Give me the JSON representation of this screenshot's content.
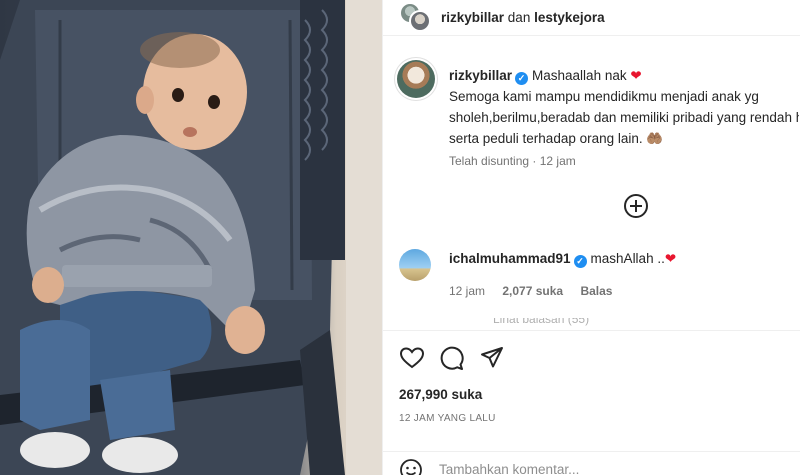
{
  "post": {
    "authors": {
      "primary": "rizkybillar",
      "conjunction": "dan",
      "secondary": "lestykejora"
    },
    "caption": {
      "username": "rizkybillar",
      "title": "Mashaallah nak",
      "title_emoji": "❤",
      "body_line1": "Semoga kami mampu mendidikmu menjadi anak yg",
      "body_line2": "sholeh,berilmu,beradab dan memiliki pribadi yang rendah hati",
      "body_line3": "serta peduli terhadap orang lain.",
      "body_emoji": "🤲🏽",
      "edited_label": "Telah disunting",
      "separator": "·",
      "time_ago": "12 jam"
    },
    "load_more_icon": "plus-circle-icon",
    "comments": [
      {
        "username": "ichalmuhammad91",
        "text": "mashAllah ..",
        "emoji": "❤",
        "time_ago": "12 jam",
        "likes": "2,077 suka",
        "reply_label": "Balas",
        "view_replies": "Lihat balasan (55)"
      }
    ],
    "actions": {
      "like_icon": "heart-icon",
      "comment_icon": "comment-icon",
      "share_icon": "share-icon"
    },
    "likes_text": "267,990 suka",
    "timestamp": "12 JAM YANG LALU",
    "comment_box": {
      "emoji_icon": "smiley-icon",
      "placeholder": "Tambahkan komentar..."
    }
  },
  "colors": {
    "verified": "#1f8ef1",
    "heart": "#e8162f",
    "muted": "#737373"
  }
}
